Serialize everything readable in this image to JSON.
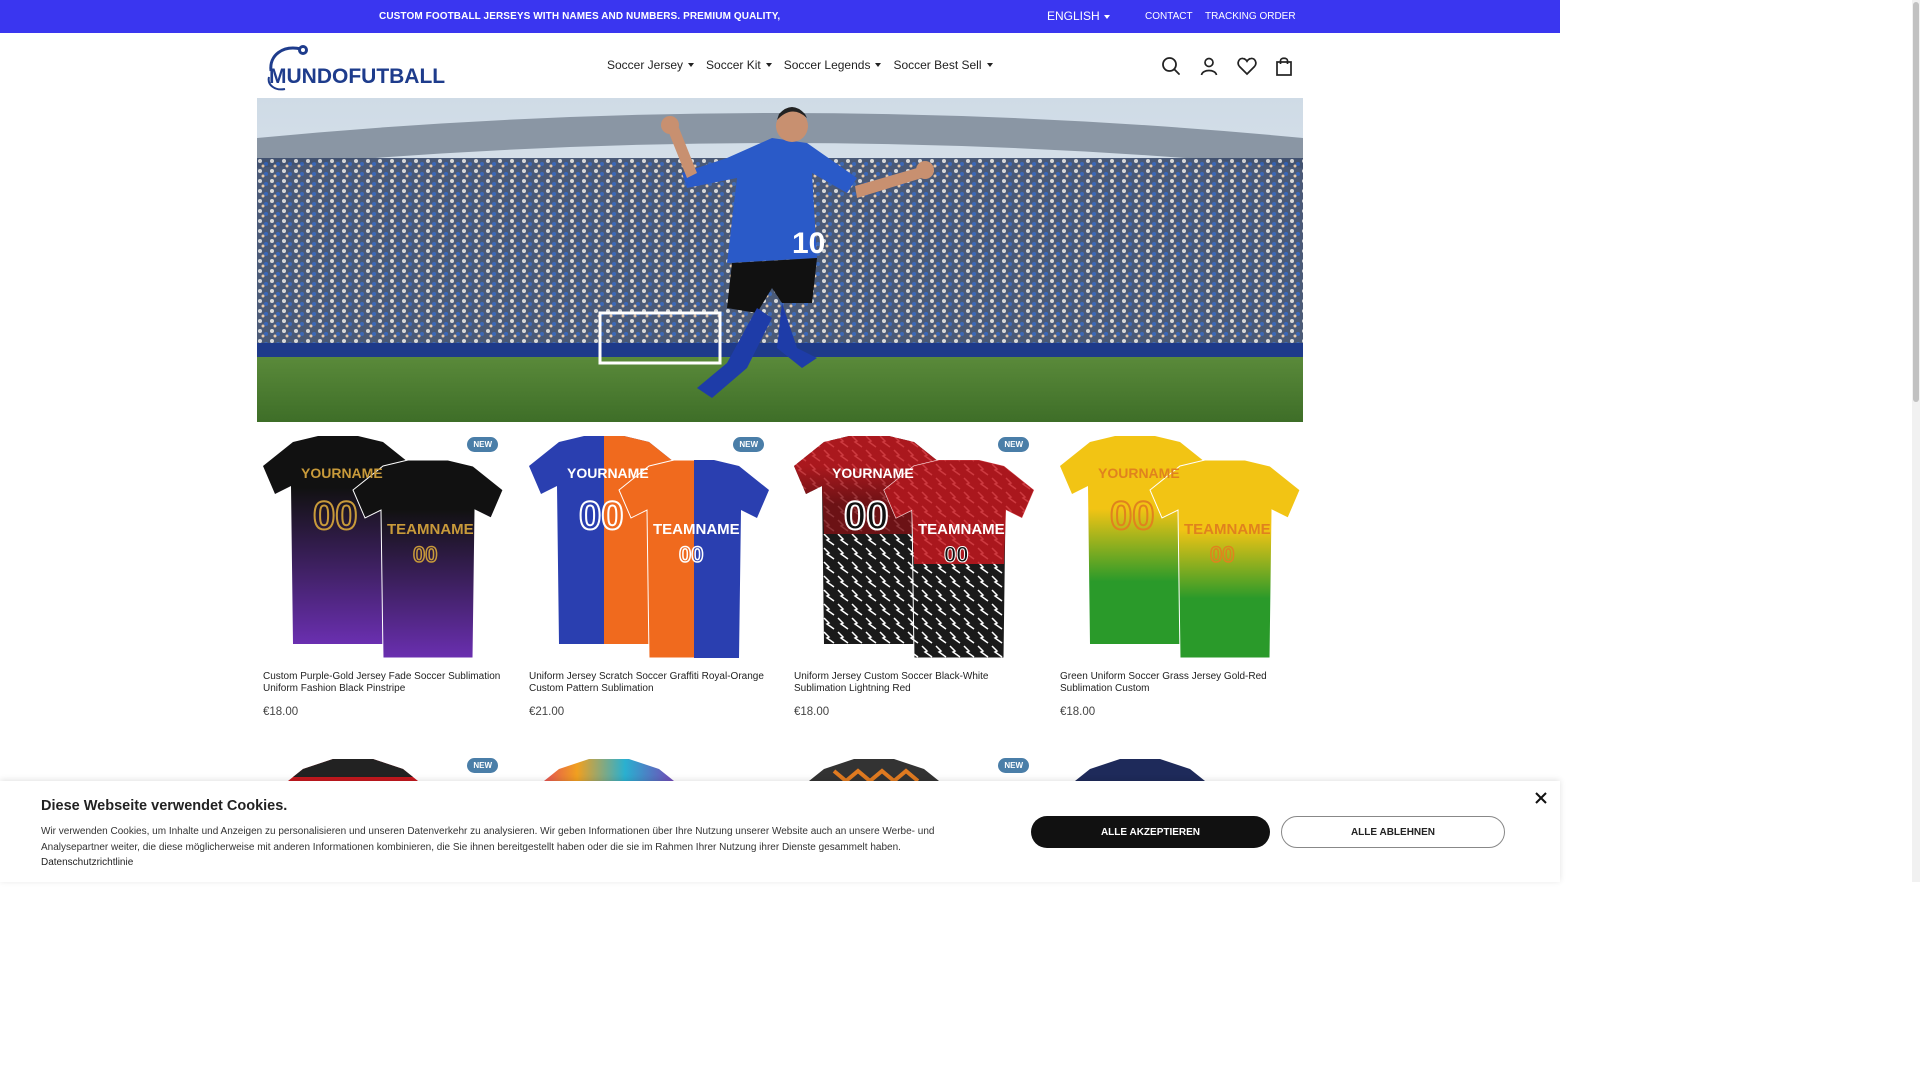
{
  "topbar": {
    "announcement": "CUSTOM FOOTBALL JERSEYS WITH NAMES AND NUMBERS. PREMIUM QUALITY, FA",
    "language": "ENGLISH",
    "contact": "CONTACT",
    "tracking": "TRACKING ORDER",
    "bg_color": "#3a36f0"
  },
  "header": {
    "logo_text": "MUNDOFUTBALL",
    "nav": [
      {
        "label": "Soccer Jersey"
      },
      {
        "label": "Soccer Kit"
      },
      {
        "label": "Soccer Legends"
      },
      {
        "label": "Soccer Best Sell"
      }
    ],
    "icons": [
      "search-icon",
      "account-icon",
      "wishlist-icon",
      "cart-icon"
    ]
  },
  "hero": {
    "jersey_number": "10"
  },
  "products": [
    {
      "title": "Custom Purple-Gold Jersey Fade Soccer Sublimation Uniform Fashion Black Pinstripe",
      "price": "€18.00",
      "badge": "NEW",
      "front_name": "YOURNAME",
      "back_name": "TEAMNAME",
      "num": "00",
      "c1": "#111111",
      "c2": "#6a2fb0",
      "txt": "#c89a3a"
    },
    {
      "title": "Uniform Jersey Scratch Soccer Graffiti Royal-Orange Custom Pattern Sublimation",
      "price": "€21.00",
      "badge": "NEW",
      "front_name": "YOURNAME",
      "back_name": "TEAMNAME",
      "num": "00",
      "c1": "#2a3fb0",
      "c2": "#f06a1e",
      "txt": "#ffffff"
    },
    {
      "title": "Uniform Jersey Custom Soccer Black-White Sublimation Lightning Red",
      "price": "€18.00",
      "badge": "NEW",
      "front_name": "YOURNAME",
      "back_name": "TEAMNAME",
      "num": "00",
      "c1": "#c4181e",
      "c2": "#1a1a1a",
      "txt": "#ffffff"
    },
    {
      "title": "Green Uniform Soccer Grass Jersey Gold-Red Sublimation Custom",
      "price": "€18.00",
      "badge": "",
      "front_name": "YOURNAME",
      "back_name": "TEAMNAME",
      "num": "00",
      "c1": "#f2c414",
      "c2": "#2a9a2a",
      "txt": "#e0821e"
    }
  ],
  "products_row2": [
    {
      "badge": "NEW",
      "c1": "#c4181e",
      "c2": "#222222"
    },
    {
      "badge": "",
      "c1": "#f0a020",
      "c2": "#8a2ab0"
    },
    {
      "badge": "NEW",
      "c1": "#333333",
      "c2": "#e07a20"
    },
    {
      "badge": "",
      "c1": "#1e2a5a",
      "c2": "#1e2a5a"
    }
  ],
  "cookie": {
    "title": "Diese Webseite verwendet Cookies.",
    "text": "Wir verwenden Cookies, um Inhalte und Anzeigen zu personalisieren und unseren Datenverkehr zu analysieren. Wir geben Informationen über Ihre Nutzung unserer Website auch an unsere Werbe- und Analysepartner weiter, die diese möglicherweise mit anderen Informationen kombinieren, die Sie ihnen bereitgestellt haben oder die sie im Rahmen Ihrer Nutzung ihrer Dienste gesammelt haben.",
    "link": "Datenschutzrichtlinie",
    "accept": "ALLE AKZEPTIEREN",
    "reject": "ALLE ABLEHNEN"
  }
}
